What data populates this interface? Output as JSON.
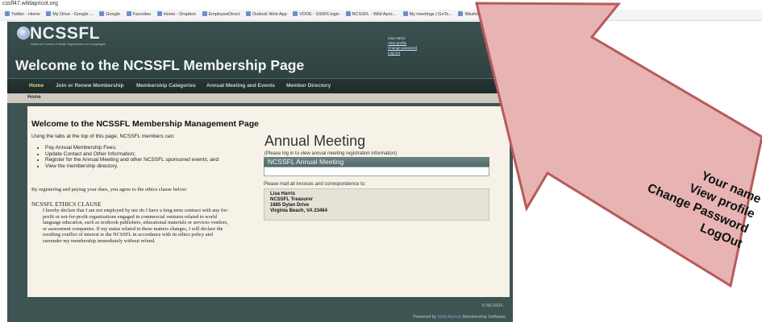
{
  "browser": {
    "url": "cssfl47.wildapricot.org",
    "bookmarks": [
      "Twitter - Home",
      "My Drive - Google ...",
      "Google",
      "Favorites",
      "Home - Dropbox",
      "EmployeeDirect",
      "Outlook Web App",
      "VDOE - SSWS login",
      "NCSSFL - Wild Apric...",
      "My meetings | GoTo...",
      "Washington Post"
    ]
  },
  "site": {
    "logo": "NCSSFL",
    "logo_sub": "National Council of State Supervisors for Languages",
    "welcome": "Welcome to the NCSSFL Membership Page",
    "user_links": [
      "Lisa Harris",
      "View profile",
      "Change password",
      "Log out"
    ],
    "nav": [
      "Home",
      "Join or Renew Membership",
      "Membership Categories",
      "Annual Meeting and Events",
      "Member Directory"
    ],
    "breadcrumb": "Home"
  },
  "content": {
    "heading": "Welcome to the NCSSFL Membership Management Page",
    "intro": "Using the tabs at the top of this page, NCSSFL members can:",
    "tasks": [
      "Pay Annual Membership Fees;",
      "Update Contact and Other Information;",
      "Register for the Annual Meeting and other NCSSFL sponsored events; and",
      "View the membership directory."
    ],
    "agree": "By registering and paying your dues, you agree to the ethics clause below:",
    "clause_title": "NCSSFL ETHICS CLAUSE",
    "clause_text": "I hereby declare that I am not employed by nor do I have a long-term contract with any for-profit or not-for-profit organizations engaged in commercial ventures related to world language education, such as textbook publishers, educational materials or services vendors, or assessment companies. If my status related to these matters changes, I will declare the resulting conflict of interest to the NCSSFL in accordance with its ethics policy and surrender my membership immediately without refund.",
    "annual_title": "Annual Meeting",
    "annual_note": "(Please log in to view annual meeting registration information)",
    "annual_box": "NCSSFL Annual Meeting",
    "mail_note": "Please mail all invoices and correspondence to:",
    "address": [
      "Lisa Harris",
      "NCSSFL Treasurer",
      "1685 Dylan Drive",
      "Virginia Beach, VA 23464"
    ]
  },
  "footer": {
    "copyright": "© NCSSFL",
    "powered_prefix": "Powered by",
    "powered_link": "Wild Apricot",
    "powered_suffix": "Membership Software"
  },
  "callout": {
    "lines": [
      "Your name",
      "View profile",
      "Change Password",
      "LogOut"
    ],
    "fill": "#e8b3b3",
    "stroke": "#b85a5a"
  }
}
